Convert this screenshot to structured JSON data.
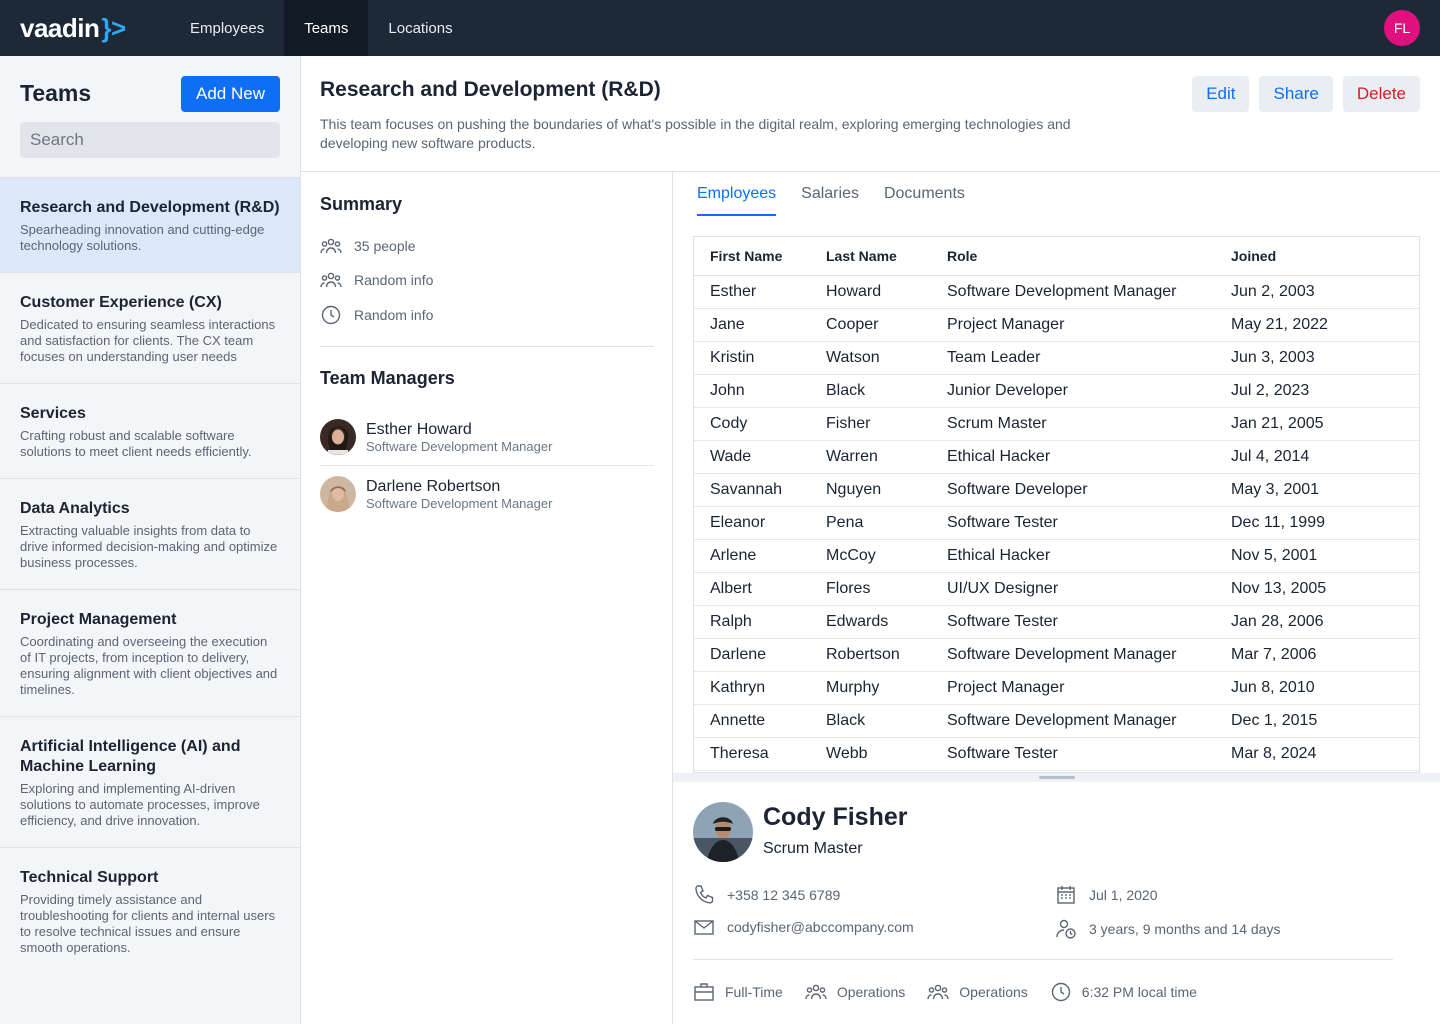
{
  "app": {
    "logo": "vaadin",
    "logo_brace": "}>",
    "nav": [
      "Employees",
      "Teams",
      "Locations"
    ],
    "user_initials": "FL",
    "colors": {
      "topbar": "#1e2938",
      "accent": "#0e6ef5",
      "danger": "#d31f1f",
      "avatar": "#e0117f"
    }
  },
  "sidebar": {
    "title": "Teams",
    "add_label": "Add New",
    "search_placeholder": "Search",
    "teams": [
      {
        "name": "Research and Development (R&D)",
        "desc": "Spearheading innovation and cutting-edge technology solutions."
      },
      {
        "name": "Customer Experience (CX)",
        "desc": "Dedicated to ensuring seamless interactions and satisfaction for clients. The CX team focuses on understanding user needs"
      },
      {
        "name": "Services",
        "desc": "Crafting robust and scalable software solutions to meet client needs efficiently."
      },
      {
        "name": "Data Analytics",
        "desc": "Extracting valuable insights from data to drive informed decision-making and optimize business processes."
      },
      {
        "name": "Project Management",
        "desc": "Coordinating and overseeing the execution of IT projects, from inception to delivery, ensuring alignment with client objectives and timelines."
      },
      {
        "name": "Artificial Intelligence (AI) and Machine Learning",
        "desc": "Exploring and implementing AI-driven solutions to automate processes, improve efficiency, and drive innovation."
      },
      {
        "name": "Technical Support",
        "desc": "Providing timely assistance and troubleshooting for clients and internal users to resolve technical issues and ensure smooth operations."
      }
    ]
  },
  "header": {
    "title": "Research and Development (R&D)",
    "desc": "This team focuses on pushing the boundaries of what's possible in the digital realm, exploring emerging technologies and developing new software products.",
    "edit": "Edit",
    "share": "Share",
    "delete": "Delete"
  },
  "summary": {
    "title": "Summary",
    "people": "35 people",
    "info1": "Random info",
    "info2": "Random info",
    "managers_title": "Team Managers",
    "managers": [
      {
        "name": "Esther Howard",
        "role": "Software Development Manager"
      },
      {
        "name": "Darlene Robertson",
        "role": "Software Development Manager"
      }
    ]
  },
  "tabs": [
    "Employees",
    "Salaries",
    "Documents"
  ],
  "grid": {
    "columns": [
      "First Name",
      "Last Name",
      "Role",
      "Joined"
    ],
    "rows": [
      [
        "Esther",
        "Howard",
        "Software Development Manager",
        "Jun 2, 2003"
      ],
      [
        "Jane",
        "Cooper",
        "Project Manager",
        "May 21, 2022"
      ],
      [
        "Kristin",
        "Watson",
        "Team Leader",
        "Jun 3, 2003"
      ],
      [
        "John",
        "Black",
        "Junior Developer",
        "Jul 2, 2023"
      ],
      [
        "Cody",
        "Fisher",
        "Scrum Master",
        "Jan 21, 2005"
      ],
      [
        "Wade",
        "Warren",
        "Ethical Hacker",
        "Jul 4, 2014"
      ],
      [
        "Savannah",
        "Nguyen",
        "Software Developer",
        "May 3, 2001"
      ],
      [
        "Eleanor",
        "Pena",
        "Software Tester",
        "Dec 11, 1999"
      ],
      [
        "Arlene",
        "McCoy",
        "Ethical Hacker",
        "Nov 5, 2001"
      ],
      [
        "Albert",
        "Flores",
        "UI/UX Designer",
        "Nov 13, 2005"
      ],
      [
        "Ralph",
        "Edwards",
        "Software Tester",
        "Jan 28, 2006"
      ],
      [
        "Darlene",
        "Robertson",
        "Software Development Manager",
        "Mar 7, 2006"
      ],
      [
        "Kathryn",
        "Murphy",
        "Project Manager",
        "Jun 8, 2010"
      ],
      [
        "Annette",
        "Black",
        "Software Development Manager",
        "Dec 1, 2015"
      ],
      [
        "Theresa",
        "Webb",
        "Software Tester",
        "Mar 8, 2024"
      ]
    ]
  },
  "detail": {
    "name": "Cody Fisher",
    "role": "Scrum Master",
    "phone": "+358 12 345 6789",
    "email": "codyfisher@abccompany.com",
    "start_date": "Jul 1, 2020",
    "tenure": "3 years, 9 months and 14 days",
    "employment": "Full-Time",
    "dept1": "Operations",
    "dept2": "Operations",
    "local_time": "6:32 PM local time"
  }
}
